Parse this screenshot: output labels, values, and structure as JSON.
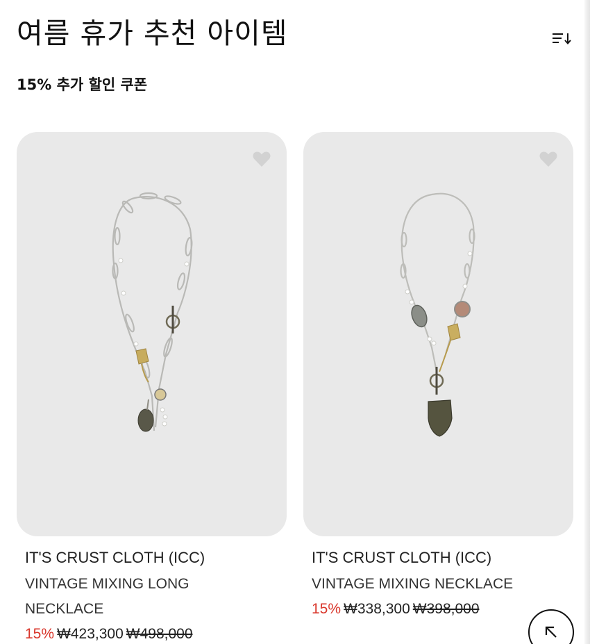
{
  "header": {
    "title": "여름 휴가 추천 아이템",
    "sort_icon": "sort-descending-icon",
    "subtitle": "15% 추가 할인 쿠폰"
  },
  "products": [
    {
      "brand": "IT'S CRUST CLOTH (ICC)",
      "name_lines": [
        "VINTAGE MIXING LONG",
        "NECKLACE"
      ],
      "discount": "15%",
      "sale_price": "₩423,300",
      "original_price": "₩498,000",
      "wishlist_icon": "heart-icon"
    },
    {
      "brand": "IT'S CRUST CLOTH (ICC)",
      "name_lines": [
        "VINTAGE MIXING NECKLACE"
      ],
      "discount": "15%",
      "sale_price": "₩338,300",
      "original_price": "₩398,000",
      "wishlist_icon": "heart-icon"
    }
  ],
  "scroll_top_icon": "arrow-up-left-icon",
  "colors": {
    "discount": "#d9362b",
    "card_background": "#e9e9e9",
    "text": "#111111"
  }
}
